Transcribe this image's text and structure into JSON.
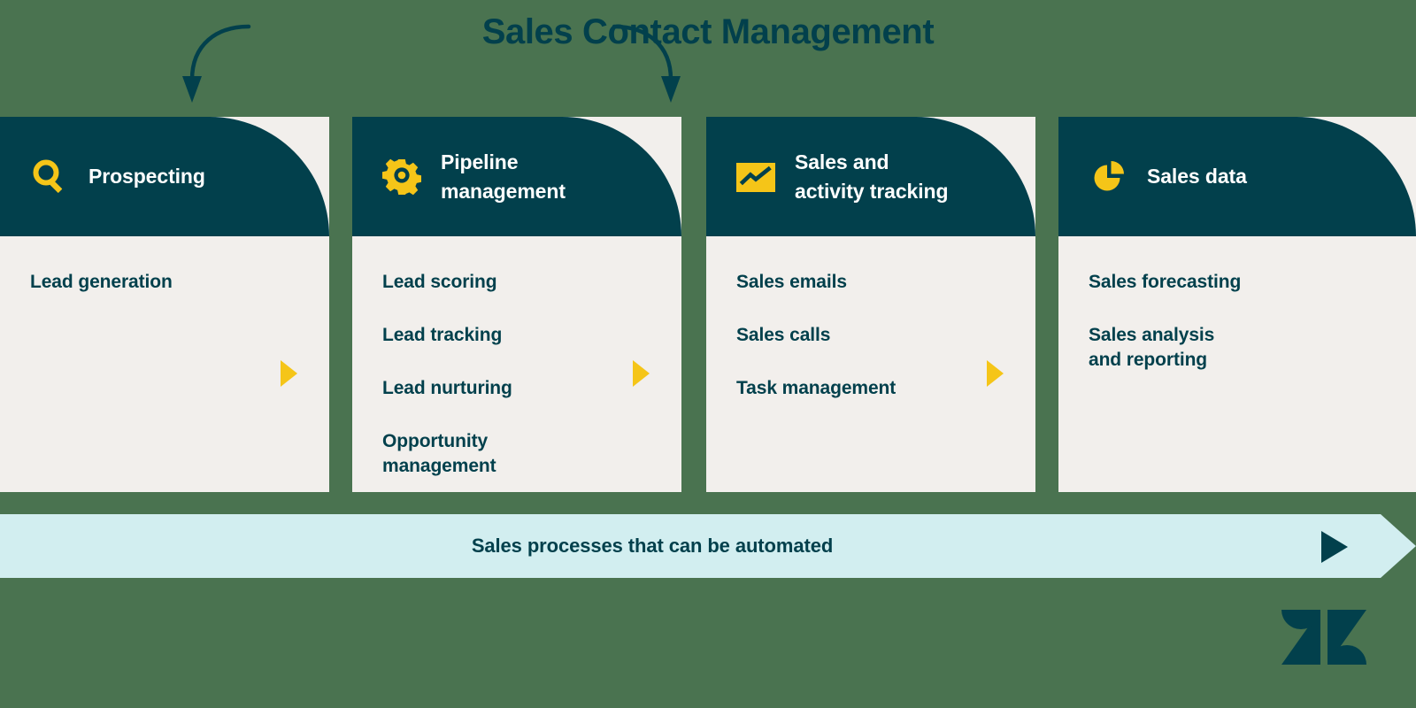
{
  "title": "Sales Contact Management",
  "colors": {
    "background": "#4a7350",
    "card_header": "#02404c",
    "card_body": "#f2efec",
    "accent_yellow": "#f5c518",
    "automation_bar": "#d2eef0",
    "text_dark": "#02404c",
    "text_light": "#ffffff"
  },
  "cards": [
    {
      "icon": "magnifier-icon",
      "title": "Prospecting",
      "items": [
        "Lead generation"
      ],
      "chevron": "chevron-right-icon"
    },
    {
      "icon": "gear-icon",
      "title": "Pipeline\nmanagement",
      "items": [
        "Lead scoring",
        "Lead tracking",
        "Lead nurturing",
        "Opportunity\nmanagement"
      ],
      "chevron": "chevron-right-icon"
    },
    {
      "icon": "line-chart-icon",
      "title": "Sales and\nactivity tracking",
      "items": [
        "Sales emails",
        "Sales calls",
        "Task management"
      ],
      "chevron": "chevron-right-icon"
    },
    {
      "icon": "pie-chart-icon",
      "title": "Sales data",
      "items": [
        "Sales forecasting",
        "Sales analysis\nand reporting"
      ],
      "chevron": ""
    }
  ],
  "automation_bar": {
    "label": "Sales processes that can be automated",
    "arrow": "arrow-right-icon"
  },
  "logo": {
    "name": "zendesk-logo"
  }
}
